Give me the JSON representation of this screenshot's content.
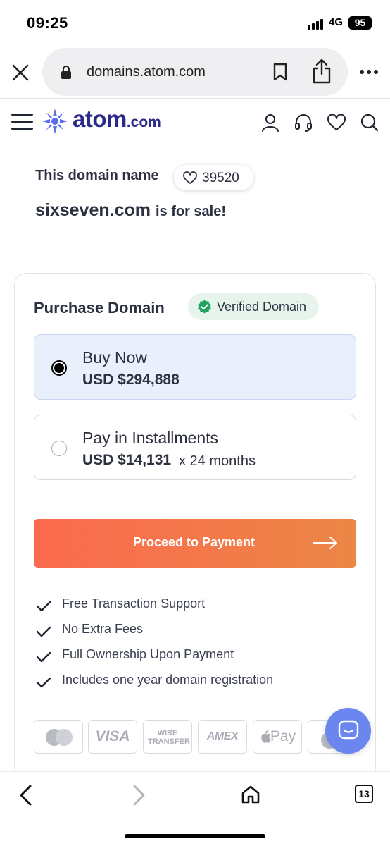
{
  "status_bar": {
    "time": "09:25",
    "network": "4G",
    "battery": "95"
  },
  "browser": {
    "url": "domains.atom.com",
    "tab_count": "13"
  },
  "site_header": {
    "logo_main": "atom",
    "logo_suffix": ".com"
  },
  "hero": {
    "line1": "This domain name",
    "favorites_count": "39520",
    "domain": "sixseven.com",
    "for_sale_suffix": "is for sale!"
  },
  "purchase": {
    "title": "Purchase Domain",
    "verified_label": "Verified Domain",
    "options": [
      {
        "label": "Buy Now",
        "price": "USD $294,888",
        "term": "",
        "selected": true
      },
      {
        "label": "Pay in Installments",
        "price": "USD $14,131",
        "term": "x 24 months",
        "selected": false
      }
    ],
    "proceed_label": "Proceed to Payment",
    "features": [
      "Free Transaction Support",
      "No Extra Fees",
      "Full Ownership Upon Payment",
      "Includes one year domain registration"
    ],
    "payment_methods": [
      "mastercard",
      "VISA",
      "WIRE TRANSFER",
      "AMEX",
      "Pay",
      "paypal"
    ]
  },
  "colors": {
    "brand": "#2b2a8a",
    "accent_orange": "#fb6a4f",
    "chat_bubble": "#6b86ef",
    "verified_green": "#1ea35d"
  }
}
